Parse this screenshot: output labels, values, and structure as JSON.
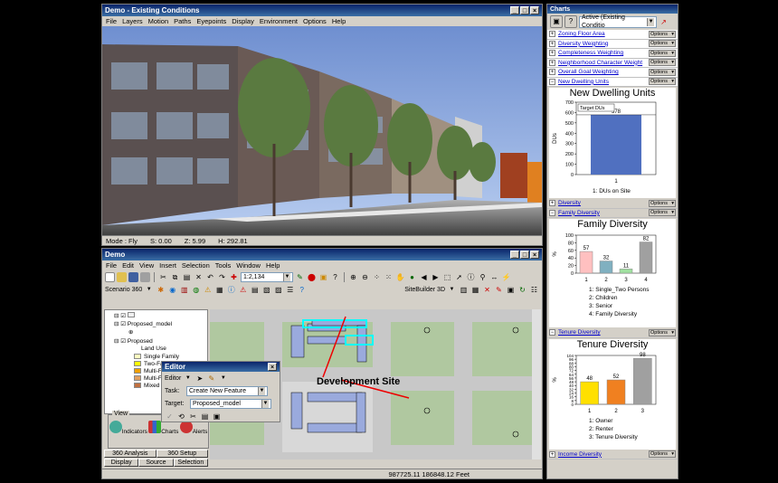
{
  "view3d": {
    "title": "Demo - Existing Conditions",
    "menu": [
      "File",
      "Layers",
      "Motion",
      "Paths",
      "Eyepoints",
      "Display",
      "Environment",
      "Options",
      "Help"
    ],
    "status": {
      "mode_label": "Mode : Fly",
      "s": "S:     0.00",
      "z": "Z:   5.99",
      "h": "H: 292.81"
    }
  },
  "map": {
    "title": "Demo",
    "menu": [
      "File",
      "Edit",
      "View",
      "Insert",
      "Selection",
      "Tools",
      "Window",
      "Help"
    ],
    "scale": "1:2,134",
    "scenario": "Scenario 360",
    "sitebuilder": "SiteBuilder 3D",
    "annotation": "Development Site",
    "coords": "987725.11  186848.12 Feet"
  },
  "toc": {
    "layers": [
      "Proposed_model",
      "Proposed",
      "Land Use"
    ],
    "landuse": [
      {
        "label": "Single Family",
        "color": "#ffffc0"
      },
      {
        "label": "Two-Family",
        "color": "#ffff00"
      },
      {
        "label": "Multi-Family",
        "color": "#f0a000"
      },
      {
        "label": "Multi-Family",
        "color": "#e0a060"
      },
      {
        "label": "Mixed Res",
        "color": "#c07040"
      }
    ],
    "view_label": "View",
    "view_buttons": [
      "Indicators",
      "Charts",
      "Alerts"
    ],
    "tabs1": [
      "360 Analysis",
      "360 Setup"
    ],
    "tabs2": [
      "Display",
      "Source",
      "Selection"
    ]
  },
  "editor": {
    "title": "Editor",
    "menu_label": "Editor",
    "task_label": "Task:",
    "task_value": "Create New Feature",
    "target_label": "Target:",
    "target_value": "Proposed_model"
  },
  "charts": {
    "title": "Charts",
    "scenario": "Active (Existing Conditio",
    "option_label": "Options",
    "rows_top": [
      "Zoning Floor Area",
      "Diversity Weighting",
      "Completeness Weighting",
      "Neighborhood Character Weight",
      "Overall Goal Weighting",
      "New Dwelling Units"
    ],
    "row_div": "Diversity",
    "row_family": "Family Diversity",
    "row_tenure": "Tenure Diversity",
    "row_income": "Income Diversity",
    "du_chart": {
      "title": "New Dwelling Units",
      "legend": "Target DUs",
      "value": 578,
      "ylim": [
        0,
        700
      ],
      "ticks": [
        0,
        100,
        200,
        300,
        400,
        500,
        600,
        700
      ],
      "ylabel": "DUs",
      "categories": [
        "1"
      ],
      "footer": "1:  DUs on Site"
    },
    "family_chart": {
      "title": "Family Diversity",
      "ylim": [
        0,
        100
      ],
      "ticks": [
        0,
        20,
        40,
        60,
        80,
        100
      ],
      "ylabel": "%",
      "categories": [
        "1",
        "2",
        "3",
        "4"
      ],
      "values": [
        57,
        32,
        11,
        82
      ],
      "colors": [
        "#ffc0c0",
        "#80b0c0",
        "#a0e0a0",
        "#a0a0a0"
      ],
      "legend": [
        "1:  Single_Two Persons",
        "2:  Children",
        "3:  Senior",
        "4:  Family Diversity"
      ]
    },
    "tenure_chart": {
      "title": "Tenure Diversity",
      "ylim": [
        0,
        104
      ],
      "ticks": [
        0,
        8,
        16,
        24,
        32,
        40,
        48,
        56,
        64,
        72,
        80,
        88,
        96,
        104
      ],
      "ylabel": "%",
      "categories": [
        "1",
        "2",
        "3"
      ],
      "values": [
        48,
        52,
        98
      ],
      "colors": [
        "#ffe000",
        "#f08020",
        "#a0a0a0"
      ],
      "legend": [
        "1:  Owner",
        "2:  Renter",
        "3:  Tenure Diversity"
      ]
    }
  }
}
